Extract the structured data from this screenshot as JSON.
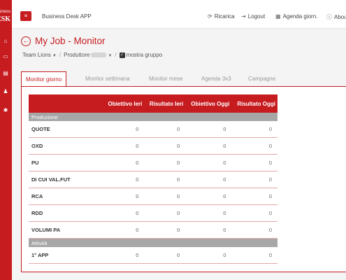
{
  "brand": {
    "line1": "usiness",
    "line2": "ESK"
  },
  "topbar": {
    "app_title": "Business Desk APP",
    "nav": [
      {
        "icon": "refresh-icon",
        "glyph": "⟳",
        "label": "Ricarica"
      },
      {
        "icon": "logout-icon",
        "glyph": "⇥",
        "label": "Logout"
      },
      {
        "icon": "calendar-icon",
        "glyph": "▦",
        "label": "Agenda giorn."
      },
      {
        "icon": "info-icon",
        "glyph": "ⓘ",
        "label": "About"
      }
    ]
  },
  "page": {
    "title": "My Job - Monitor"
  },
  "breadcrumb": {
    "team": "Team Lions",
    "produttore": "Produttore",
    "mostra": "mostra gruppo"
  },
  "tabs": [
    "Monitor giorno",
    "Monitor settimana",
    "Monitor mese",
    "Agenda 3x3",
    "Campagne"
  ],
  "table": {
    "headers": [
      "",
      "Obiettivo Ieri",
      "Risultato Ieri",
      "Obiettivo Oggi",
      "Risultato Oggi"
    ],
    "groups": [
      {
        "name": "Produzione",
        "rows": [
          {
            "label": "QUOTE",
            "values": [
              "0",
              "0",
              "0",
              "0"
            ]
          },
          {
            "label": "OXD",
            "values": [
              "0",
              "0",
              "0",
              "0"
            ]
          },
          {
            "label": "PU",
            "values": [
              "0",
              "0",
              "0",
              "0"
            ]
          },
          {
            "label": "DI CUI VAL.FUT",
            "values": [
              "0",
              "0",
              "0",
              "0"
            ]
          },
          {
            "label": "RCA",
            "values": [
              "0",
              "0",
              "0",
              "0"
            ]
          },
          {
            "label": "RDD",
            "values": [
              "0",
              "0",
              "0",
              "0"
            ]
          },
          {
            "label": "VOLUMI PA",
            "values": [
              "0",
              "0",
              "0",
              "0"
            ]
          }
        ]
      },
      {
        "name": "Attività",
        "rows": [
          {
            "label": "1° APP",
            "values": [
              "0",
              "0",
              "0",
              "0"
            ]
          }
        ]
      }
    ]
  },
  "colors": {
    "accent": "#c61b1f",
    "group_bg": "#a7a7a7",
    "row_border": "#e3a7a7"
  }
}
